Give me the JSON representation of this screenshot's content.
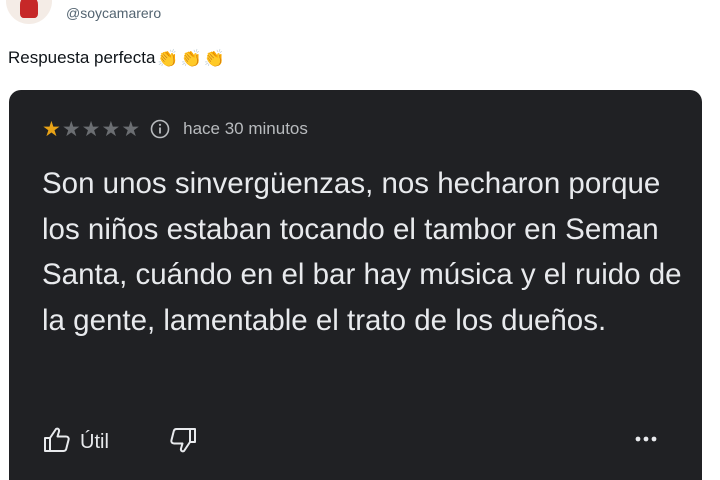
{
  "tweet": {
    "handle": "@soycamarero",
    "text": "Respuesta perfecta",
    "emojis": [
      "👏",
      "👏",
      "👏"
    ]
  },
  "review": {
    "rating": 1,
    "max_rating": 5,
    "time": "hace 30 minutos",
    "text": "Son unos sinvergüenzas, nos hecharon porque los niños estaban tocando el tambor en Seman Santa, cuándo en el bar hay música y el ruido de la gente, lamentable el trato de los dueños.",
    "like_label": "Útil",
    "icons": [
      "star-icon",
      "info-icon",
      "thumbs-up-icon",
      "thumbs-down-icon",
      "more-options-icon"
    ],
    "colors": {
      "card_bg": "#202124",
      "star_on": "#e8a317",
      "star_off": "#6b6e72",
      "text": "#e8eaed"
    }
  }
}
